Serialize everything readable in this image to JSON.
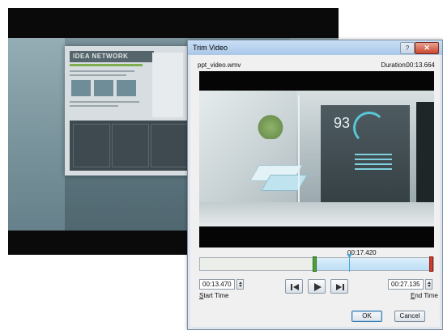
{
  "dialog": {
    "title": "Trim Video",
    "help_glyph": "?",
    "close_glyph": "✕",
    "file_name": "ppt_video.wmv",
    "duration_label": "Duration:",
    "duration_value": "00:13.664"
  },
  "background_slide": {
    "website_title": "IDEA NETWORK"
  },
  "preview": {
    "panel_number": "93"
  },
  "timeline": {
    "current_time": "00:17.420",
    "start_position": 0.49,
    "playhead_position": 0.64,
    "end_position": 1.0,
    "colors": {
      "start_handle": "#4ca53a",
      "end_handle": "#d43a2a",
      "playhead": "#49a6d8",
      "selection": "#bcdff5"
    }
  },
  "start_time": {
    "value": "00:13.470",
    "label_accel": "S",
    "label_rest": "tart Time"
  },
  "end_time": {
    "value": "00:27.135",
    "label_accel": "E",
    "label_rest": "nd Time"
  },
  "transport": {
    "previous_frame_icon": "previous-frame-icon",
    "play_icon": "play-icon",
    "next_frame_icon": "next-frame-icon"
  },
  "buttons": {
    "ok": "OK",
    "cancel": "Cancel"
  }
}
